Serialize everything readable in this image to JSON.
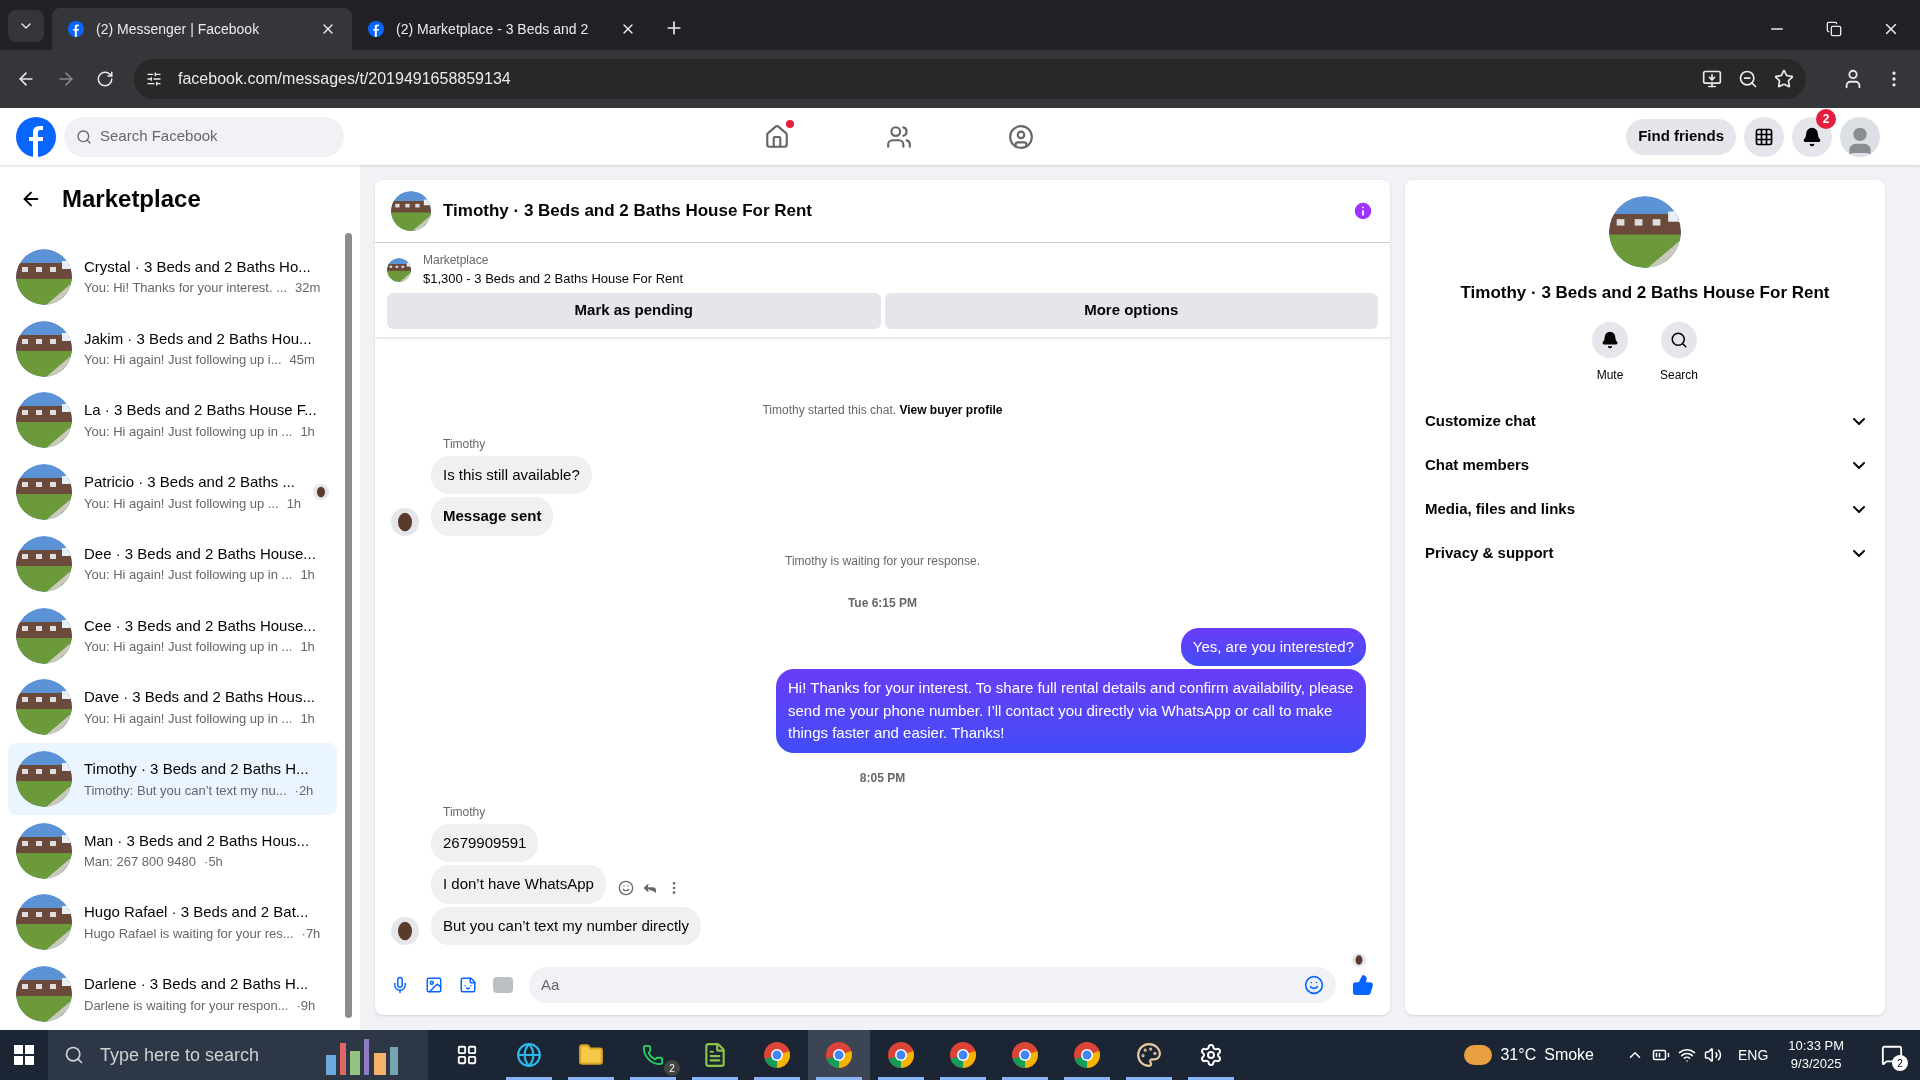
{
  "browser": {
    "tabs": [
      {
        "title": "(2) Messenger | Facebook",
        "selected": true
      },
      {
        "title": "(2) Marketplace - 3 Beds and 2",
        "selected": false
      }
    ],
    "url": "facebook.com/messages/t/2019491658859134"
  },
  "header": {
    "search_placeholder": "Search Facebook",
    "nav": [
      {
        "kind": "home",
        "selected": false,
        "dot": true
      },
      {
        "kind": "friends",
        "selected": false,
        "dot": false
      },
      {
        "kind": "groups",
        "selected": false,
        "dot": false
      }
    ],
    "find_friends": "Find friends",
    "notification_count": "2"
  },
  "sidebar": {
    "title": "Marketplace",
    "items": [
      {
        "title": "Crystal · 3 Beds and 2 Baths Ho...",
        "preview": "You: Hi! Thanks for your interest. ...",
        "time": "32m",
        "selected": false,
        "seen": false
      },
      {
        "title": "Jakim · 3 Beds and 2 Baths Hou...",
        "preview": "You: Hi again! Just following up i...",
        "time": "45m",
        "selected": false,
        "seen": false
      },
      {
        "title": "La · 3 Beds and 2 Baths House F...",
        "preview": "You: Hi again! Just following up in ...",
        "time": "1h",
        "selected": false,
        "seen": false
      },
      {
        "title": "Patricio · 3 Beds and 2 Baths ...",
        "preview": "You: Hi again! Just following up ...",
        "time": "1h",
        "selected": false,
        "seen": true
      },
      {
        "title": "Dee · 3 Beds and 2 Baths House...",
        "preview": "You: Hi again! Just following up in ...",
        "time": "1h",
        "selected": false,
        "seen": false
      },
      {
        "title": "Cee · 3 Beds and 2 Baths House...",
        "preview": "You: Hi again! Just following up in ...",
        "time": "1h",
        "selected": false,
        "seen": false
      },
      {
        "title": "Dave · 3 Beds and 2 Baths Hous...",
        "preview": "You: Hi again! Just following up in ...",
        "time": "1h",
        "selected": false,
        "seen": false
      },
      {
        "title": "Timothy · 3 Beds and 2 Baths H...",
        "preview": "Timothy: But you can’t text my nu...",
        "time": "·2h",
        "selected": true,
        "seen": false
      },
      {
        "title": "Man · 3 Beds and 2 Baths Hous...",
        "preview": "Man: 267 800 9480",
        "time": "·5h",
        "selected": false,
        "seen": false
      },
      {
        "title": "Hugo Rafael · 3 Beds and 2 Bat...",
        "preview": "Hugo Rafael is waiting for your res...",
        "time": "·7h",
        "selected": false,
        "seen": false
      },
      {
        "title": "Darlene · 3 Beds and 2 Baths H...",
        "preview": "Darlene is waiting for your respon...",
        "time": "·9h",
        "selected": false,
        "seen": false
      }
    ]
  },
  "chat": {
    "title": "Timothy · 3 Beds and 2 Baths House For Rent",
    "listing_label": "Marketplace",
    "listing": "$1,300 - 3 Beds and 2 Baths House For Rent",
    "actions": [
      "Mark as pending",
      "More options"
    ],
    "messages": [
      {
        "kind": "system",
        "text": "Timothy started this chat.",
        "link": "View buyer profile"
      },
      {
        "kind": "incoming",
        "sender": "Timothy",
        "bubbles": [
          {
            "text": "Is this still available?",
            "bold": false,
            "actions": false
          },
          {
            "text": "Message sent",
            "bold": true,
            "actions": false
          }
        ]
      },
      {
        "kind": "system",
        "text": "Timothy is waiting for your response."
      },
      {
        "kind": "time",
        "text": "Tue 6:15 PM"
      },
      {
        "kind": "outgoing",
        "bubbles": [
          {
            "text": "Yes, are you interested?"
          },
          {
            "text": "Hi! Thanks for your interest. To share full rental details and confirm availability, please send me your phone number. I’ll contact you directly via WhatsApp or call to make things faster and easier. Thanks!"
          }
        ]
      },
      {
        "kind": "time",
        "text": "8:05 PM"
      },
      {
        "kind": "incoming",
        "sender": "Timothy",
        "bubbles": [
          {
            "text": "2679909591",
            "bold": false,
            "actions": false
          },
          {
            "text": "I don’t have WhatsApp",
            "bold": false,
            "actions": true
          },
          {
            "text": "But you can’t text my number directly",
            "bold": false,
            "actions": false
          }
        ]
      }
    ],
    "composer_placeholder": "Aa"
  },
  "details": {
    "title": "Timothy · 3 Beds and 2 Baths House For Rent",
    "buttons": [
      {
        "kind": "mute",
        "label": "Mute"
      },
      {
        "kind": "search",
        "label": "Search"
      }
    ],
    "sections": [
      {
        "label": "Customize chat",
        "expanded": false
      },
      {
        "label": "Chat members",
        "expanded": false
      },
      {
        "label": "Media, files and links",
        "expanded": false
      },
      {
        "label": "Privacy & support",
        "expanded": false
      }
    ]
  },
  "taskbar": {
    "search_placeholder": "Type here to search",
    "apps": [
      {
        "kind": "taskview",
        "running": false,
        "selected": false
      },
      {
        "kind": "edge",
        "running": true,
        "selected": false
      },
      {
        "kind": "files",
        "running": true,
        "selected": false
      },
      {
        "kind": "whatsapp",
        "running": true,
        "selected": false,
        "badge": "2"
      },
      {
        "kind": "notepad",
        "running": true,
        "selected": false
      },
      {
        "kind": "chrome",
        "running": true,
        "selected": false
      },
      {
        "kind": "chrome",
        "running": true,
        "selected": true
      },
      {
        "kind": "chrome",
        "running": true,
        "selected": false
      },
      {
        "kind": "chrome",
        "running": true,
        "selected": false
      },
      {
        "kind": "chrome",
        "running": true,
        "selected": false
      },
      {
        "kind": "chrome",
        "running": true,
        "selected": false
      },
      {
        "kind": "paint",
        "running": true,
        "selected": false
      },
      {
        "kind": "settings",
        "running": true,
        "selected": false
      }
    ],
    "weather_temp": "31°C",
    "weather_text": "Smoke",
    "language": "ENG",
    "time": "10:33 PM",
    "date": "9/3/2025",
    "notifications": "2"
  }
}
